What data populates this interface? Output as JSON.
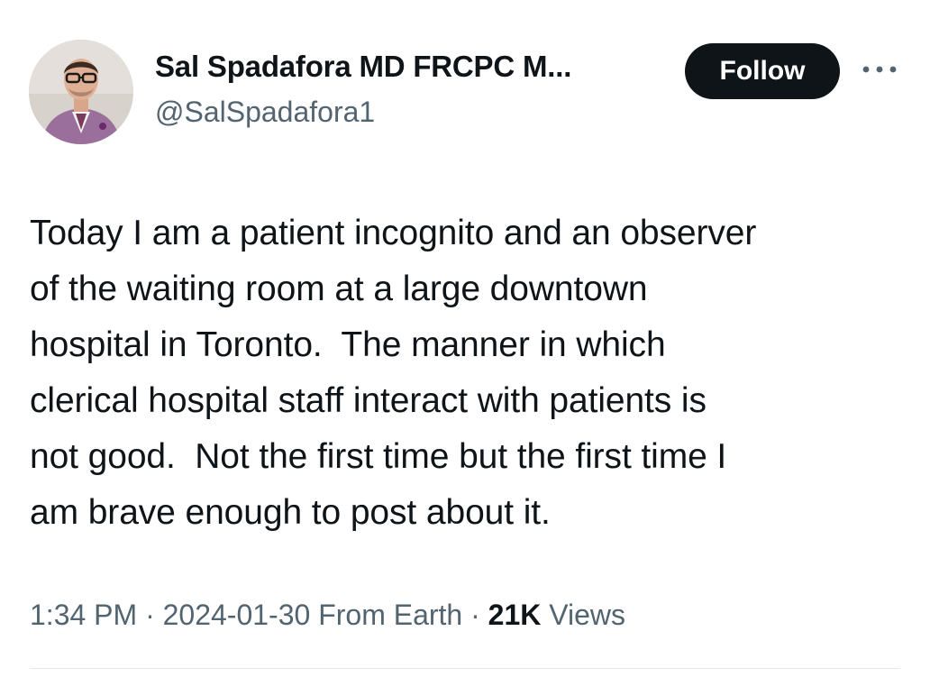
{
  "author": {
    "display_name": "Sal Spadafora MD FRCPC M...",
    "handle": "@SalSpadafora1",
    "avatar_icon": "profile-photo"
  },
  "actions": {
    "follow_label": "Follow",
    "more_icon": "more-horizontal-icon"
  },
  "tweet": {
    "text": "Today I am a patient incognito and an observer\nof the waiting room at a large downtown\nhospital in Toronto.  The manner in which\nclerical hospital staff interact with patients is\nnot good.  Not the first time but the first time I\nam brave enough to post about it."
  },
  "meta": {
    "time": "1:34 PM",
    "separator": "·",
    "date": "2024-01-30",
    "source": "From Earth",
    "views_count": "21K",
    "views_label": "Views"
  },
  "colors": {
    "text_primary": "#0f1419",
    "text_secondary": "#536471",
    "follow_bg": "#0f1419",
    "follow_text": "#ffffff",
    "divider": "#e6e9eb"
  }
}
